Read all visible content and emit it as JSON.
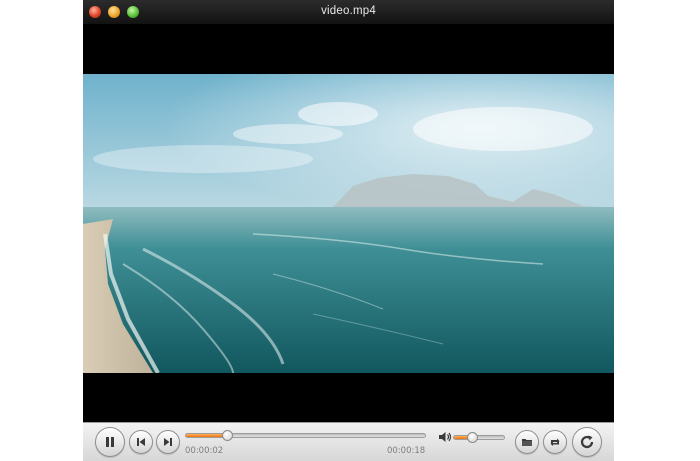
{
  "window": {
    "title": "video.mp4"
  },
  "player": {
    "current_time": "00:00:02",
    "total_time": "00:00:18",
    "progress": 0.17,
    "volume": 0.35,
    "state": "playing"
  },
  "icons": {
    "close": "close-icon",
    "minimize": "minimize-icon",
    "maximize": "maximize-icon",
    "play_pause": "pause-icon",
    "previous": "skip-previous-icon",
    "next": "skip-next-icon",
    "volume": "speaker-icon",
    "open": "folder-icon",
    "repeat": "repeat-icon",
    "refresh": "refresh-icon"
  },
  "colors": {
    "progress_fill": "#ee7410",
    "titlebar": "#1e1e1e",
    "letterbox": "#000000"
  }
}
